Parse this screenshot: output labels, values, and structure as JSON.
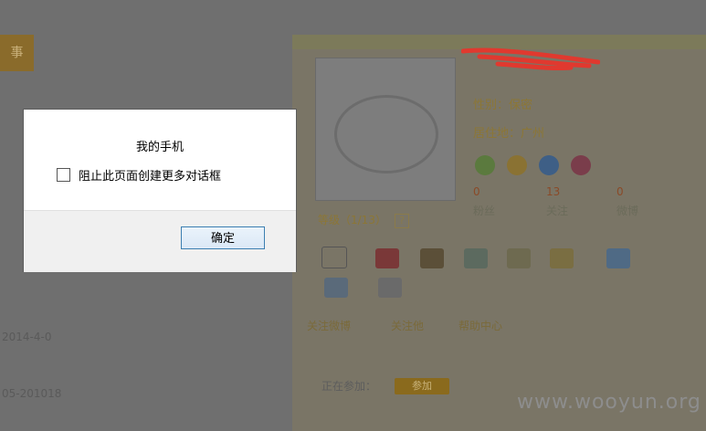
{
  "dialog": {
    "message": "我的手机",
    "checkbox_label": "阻止此页面创建更多对话框",
    "checkbox_checked": false,
    "ok_label": "确定"
  },
  "page": {
    "tab_label": "事",
    "left_text_1": "2014-4-0",
    "left_text_2": "05-201018",
    "watermark": "www.wooyun.org",
    "profile": {
      "gender_line": "性别：保密",
      "location_line": "居住地：广州",
      "stats": [
        {
          "value": "0",
          "label": "粉丝"
        },
        {
          "value": "13",
          "label": "关注"
        },
        {
          "value": "0",
          "label": "微博"
        }
      ],
      "level_label": "等级（1/13）",
      "follow_links": [
        "关注微博",
        "关注他",
        "帮助中心"
      ],
      "join_label": "正在参加：",
      "join_button": "参加"
    }
  },
  "colors": {
    "overlay": "#6f6f6f",
    "ok_border": "#3c7fb1",
    "scribble": "#e0392f"
  }
}
